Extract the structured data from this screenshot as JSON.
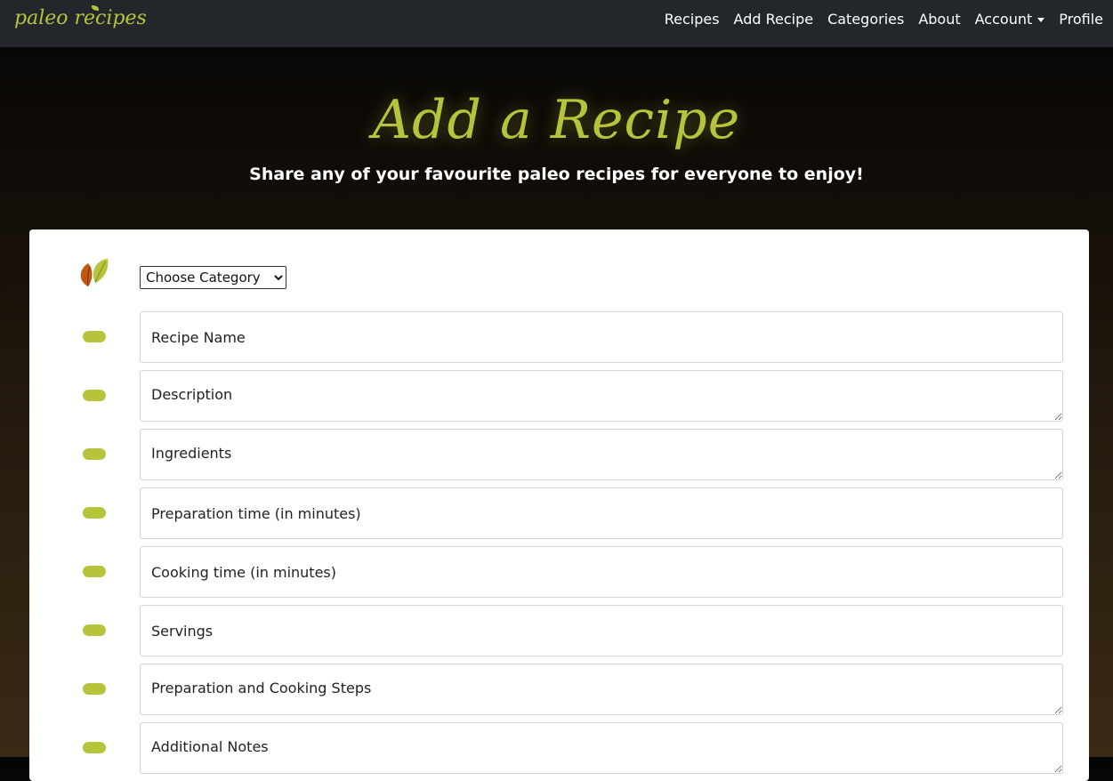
{
  "navbar": {
    "brand": "paleo recipes",
    "links": [
      "Recipes",
      "Add Recipe",
      "Categories",
      "About",
      "Account",
      "Profile"
    ]
  },
  "hero": {
    "title": "Add a Recipe",
    "subtitle": "Share any of your favourite paleo recipes for everyone to enjoy!"
  },
  "form": {
    "category_select": "Choose Category",
    "fields": [
      {
        "placeholder": "Recipe Name",
        "type": "input"
      },
      {
        "placeholder": "Description",
        "type": "textarea"
      },
      {
        "placeholder": "Ingredients",
        "type": "textarea"
      },
      {
        "placeholder": "Preparation time (in minutes)",
        "type": "input"
      },
      {
        "placeholder": "Cooking time (in minutes)",
        "type": "input"
      },
      {
        "placeholder": "Servings",
        "type": "input"
      },
      {
        "placeholder": "Preparation and Cooking Steps",
        "type": "textarea"
      },
      {
        "placeholder": "Additional Notes",
        "type": "textarea"
      }
    ]
  },
  "colors": {
    "accent": "#b5c43a",
    "navbar": "#23272b",
    "leaf_orange": "#c0580e"
  },
  "icons": {
    "category": "leaves-icon",
    "field": "pill-icon",
    "dropdown": "caret-down-icon"
  }
}
